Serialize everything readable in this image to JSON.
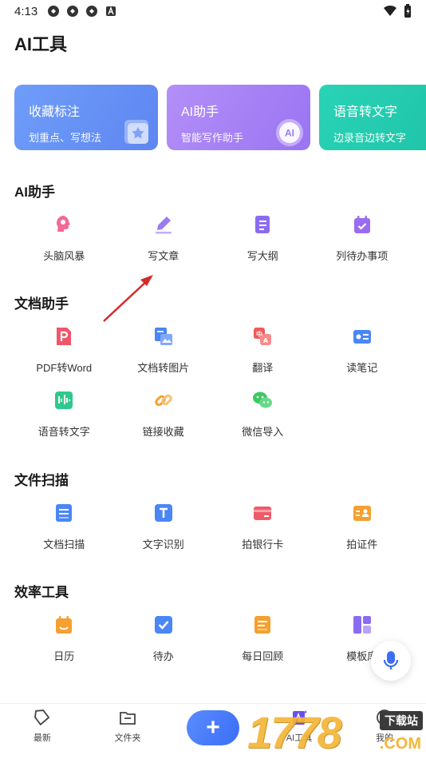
{
  "status": {
    "time": "4:13"
  },
  "page_title": "AI工具",
  "cards": [
    {
      "title": "收藏标注",
      "subtitle": "划重点、写想法"
    },
    {
      "title": "AI助手",
      "subtitle": "智能写作助手",
      "badge": "AI"
    },
    {
      "title": "语音转文字",
      "subtitle": "边录音边转文字"
    }
  ],
  "sections": {
    "ai": {
      "title": "AI助手",
      "items": [
        {
          "label": "头脑风暴",
          "icon": "lightbulb-head-icon",
          "color": "#f06a9a"
        },
        {
          "label": "写文章",
          "icon": "pen-icon",
          "color": "#9a7bf2"
        },
        {
          "label": "写大纲",
          "icon": "outline-icon",
          "color": "#8b6cf0"
        },
        {
          "label": "列待办事项",
          "icon": "calendar-check-icon",
          "color": "#9a6cf0"
        }
      ]
    },
    "doc": {
      "title": "文档助手",
      "items": [
        {
          "label": "PDF转Word",
          "icon": "pdf-icon",
          "color": "#f0566a"
        },
        {
          "label": "文档转图片",
          "icon": "doc-to-image-icon",
          "color": "#4a86f5"
        },
        {
          "label": "翻译",
          "icon": "translate-icon",
          "color": "#f05a5a"
        },
        {
          "label": "读笔记",
          "icon": "read-notes-icon",
          "color": "#4a86f5"
        },
        {
          "label": "语音转文字",
          "icon": "voice-to-text-icon",
          "color": "#2ec98c"
        },
        {
          "label": "链接收藏",
          "icon": "link-icon",
          "color": "#f5a030"
        },
        {
          "label": "微信导入",
          "icon": "wechat-icon",
          "color": "#3cc862"
        }
      ]
    },
    "scan": {
      "title": "文件扫描",
      "items": [
        {
          "label": "文档扫描",
          "icon": "doc-scan-icon",
          "color": "#4a86f5"
        },
        {
          "label": "文字识别",
          "icon": "text-recognition-icon",
          "color": "#4a86f5"
        },
        {
          "label": "拍银行卡",
          "icon": "bank-card-icon",
          "color": "#f05a6a"
        },
        {
          "label": "拍证件",
          "icon": "id-card-icon",
          "color": "#f5a030"
        }
      ]
    },
    "eff": {
      "title": "效率工具",
      "items": [
        {
          "label": "日历",
          "icon": "calendar-icon",
          "color": "#f5a030"
        },
        {
          "label": "待办",
          "icon": "todo-check-icon",
          "color": "#4a86f5"
        },
        {
          "label": "每日回顾",
          "icon": "daily-review-icon",
          "color": "#f5a030"
        },
        {
          "label": "模板库",
          "icon": "template-icon",
          "color": "#8b6cf0"
        }
      ]
    }
  },
  "nav": {
    "recent": "最新",
    "folder": "文件夹",
    "add": "+",
    "ai_tools": "AI工具",
    "me": "我的"
  },
  "watermark": {
    "text": "1778",
    "tag": "下载站",
    "domain": ".COM"
  }
}
